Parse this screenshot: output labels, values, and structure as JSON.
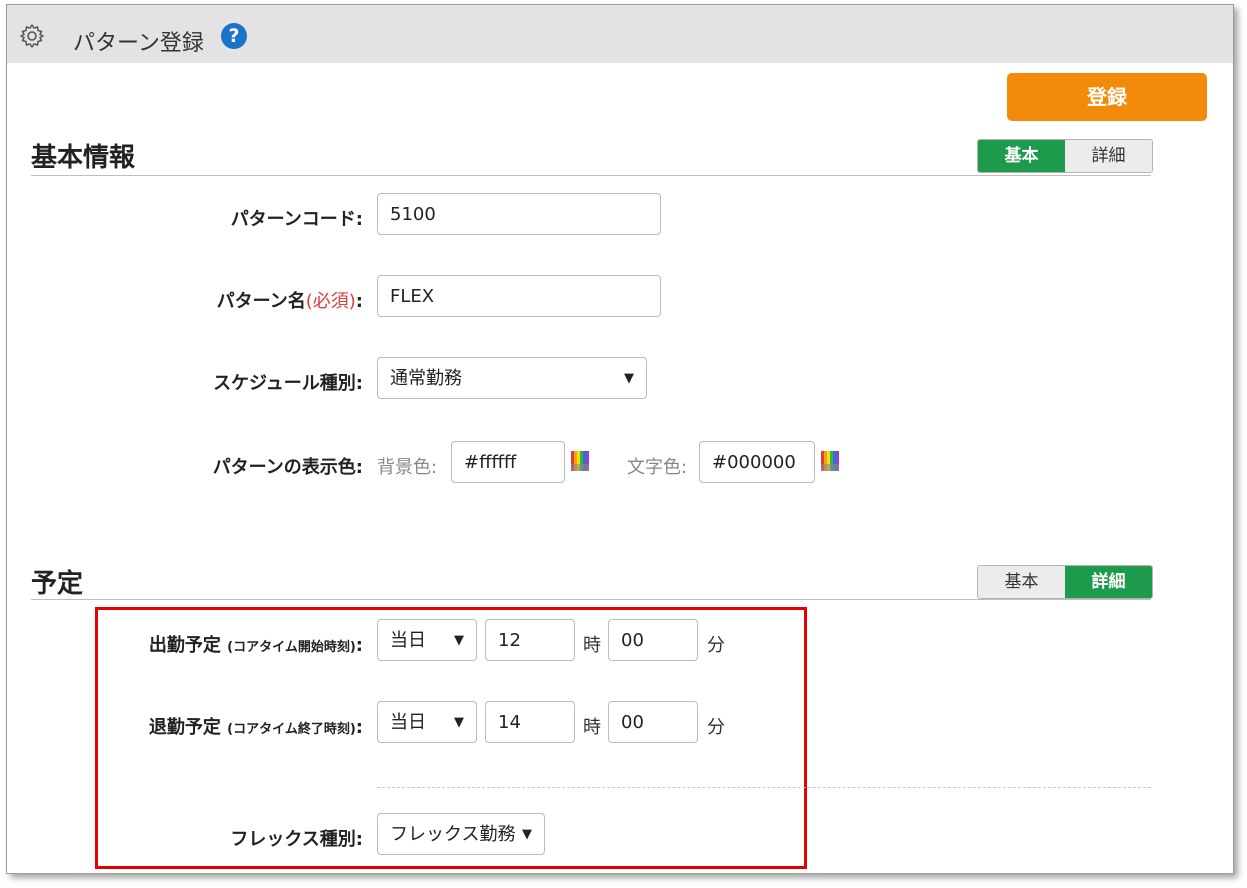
{
  "header": {
    "title": "パターン登録",
    "help_label": "?",
    "icons": [
      "gear-icon",
      "help-icon"
    ]
  },
  "actions": {
    "submit_label": "登録"
  },
  "sections": {
    "basic": {
      "title": "基本情報",
      "toggle": {
        "basic": "基本",
        "detail": "詳細",
        "active": "basic"
      }
    },
    "schedule": {
      "title": "予定",
      "toggle": {
        "basic": "基本",
        "detail": "詳細",
        "active": "detail"
      }
    }
  },
  "form": {
    "pattern_code": {
      "label": "パターンコード:",
      "value": "5100"
    },
    "pattern_name": {
      "label_main": "パターン名",
      "label_required": "(必須)",
      "label_colon": ":",
      "value": "FLEX"
    },
    "schedule_type": {
      "label": "スケジュール種別:",
      "value": "通常勤務"
    },
    "display_color": {
      "label": "パターンの表示色:",
      "bg_label": "背景色:",
      "bg_value": "#ffffff",
      "text_label": "文字色:",
      "text_value": "#000000"
    },
    "start": {
      "label_main": "出勤予定",
      "label_small": "(コアタイム開始時刻)",
      "label_colon": ":",
      "day": "当日",
      "hour": "12",
      "hour_unit": "時",
      "minute": "00",
      "minute_unit": "分"
    },
    "end": {
      "label_main": "退勤予定",
      "label_small": "(コアタイム終了時刻)",
      "label_colon": ":",
      "day": "当日",
      "hour": "14",
      "hour_unit": "時",
      "minute": "00",
      "minute_unit": "分"
    },
    "flex_type": {
      "label": "フレックス種別:",
      "value": "フレックス勤務"
    }
  },
  "colors": {
    "submit": "#f28a0b",
    "toggle_active": "#1e9a4c",
    "highlight_box": "#e60000",
    "help": "#1a73c8"
  }
}
